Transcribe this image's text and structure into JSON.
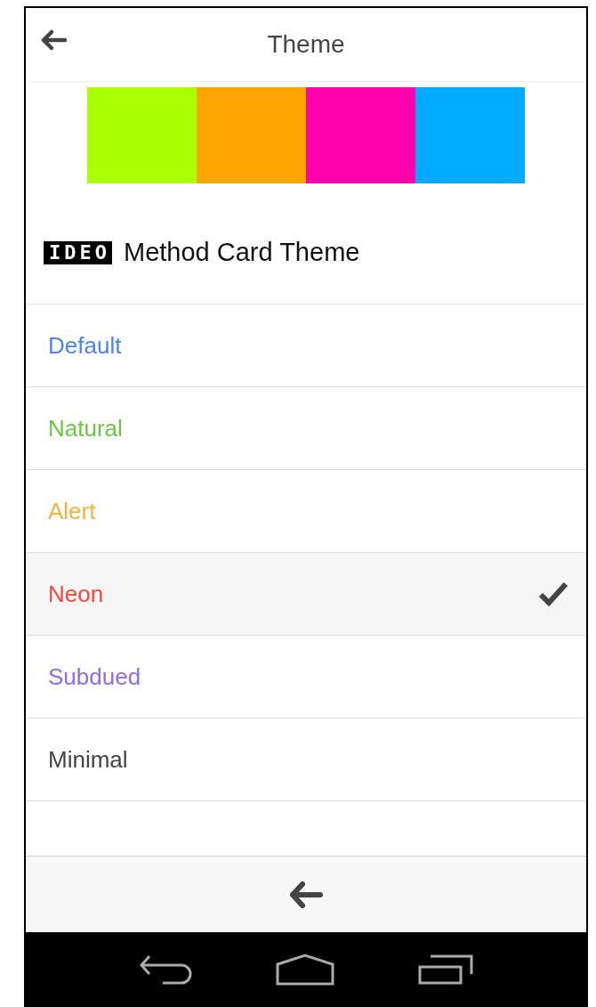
{
  "header": {
    "title": "Theme"
  },
  "palette": [
    {
      "color": "#aaff00"
    },
    {
      "color": "#ffa500"
    },
    {
      "color": "#ff00aa"
    },
    {
      "color": "#00aaff"
    }
  ],
  "brand": {
    "logo": "IDEO",
    "label": "Method Card Theme"
  },
  "themes": [
    {
      "label": "Default",
      "color": "#4a86e8",
      "selected": false
    },
    {
      "label": "Natural",
      "color": "#6cc644",
      "selected": false
    },
    {
      "label": "Alert",
      "color": "#f2b33d",
      "selected": false
    },
    {
      "label": "Neon",
      "color": "#f4473b",
      "selected": true
    },
    {
      "label": "Subdued",
      "color": "#8e6ce8",
      "selected": false
    },
    {
      "label": "Minimal",
      "color": "#444444",
      "selected": false
    }
  ]
}
